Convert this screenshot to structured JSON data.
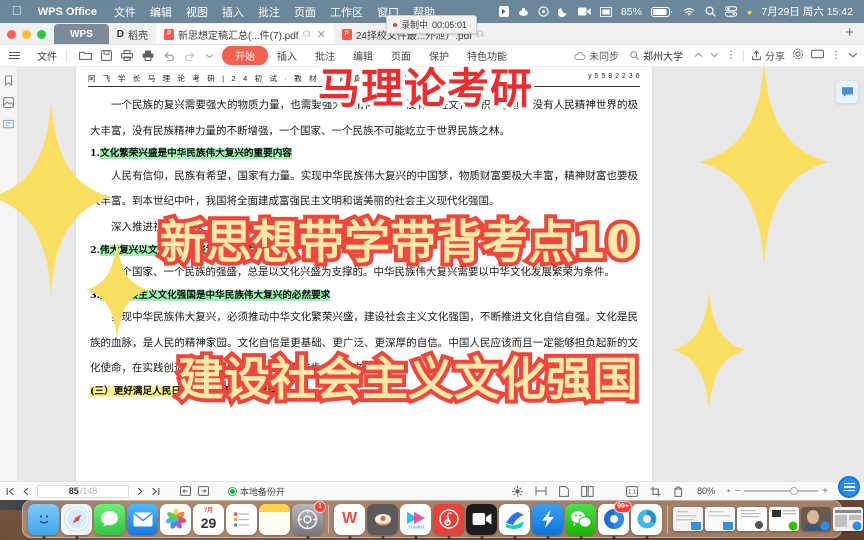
{
  "menubar": {
    "apple_icon": "apple-icon",
    "app_name": "WPS Office",
    "items": [
      "文件",
      "编辑",
      "视图",
      "插入",
      "批注",
      "页面",
      "工作区",
      "窗口",
      "帮助"
    ],
    "battery": "85%",
    "datetime": "7月29日 周六  15:42",
    "right_icons": [
      "input-source-icon",
      "screenshot-icon",
      "record-circle-icon",
      "do-not-disturb-moon-icon",
      "camera-icon",
      "keyboard-icon",
      "battery-icon",
      "wifi-icon",
      "search-icon",
      "control-center-icon"
    ]
  },
  "recording": {
    "label": "录制中",
    "time": "00:05:01"
  },
  "tabs": {
    "wps_label": "WPS",
    "docer_label": "稻壳",
    "items": [
      {
        "label": "新思想定稿汇总(...件(7).pdf",
        "active": true
      },
      {
        "label": "24择校文件最...外泄）.pdf",
        "active": false
      }
    ],
    "new_tab": "+"
  },
  "ribbon": {
    "file_label": "文件",
    "tabs": [
      {
        "label": "开始",
        "active": true
      },
      {
        "label": "插入",
        "active": false
      },
      {
        "label": "批注",
        "active": false
      },
      {
        "label": "编辑",
        "active": false
      },
      {
        "label": "页面",
        "active": false
      },
      {
        "label": "保护",
        "active": false
      },
      {
        "label": "特色功能",
        "active": false
      }
    ],
    "sync_status": "未同步",
    "search_value": "郑州大学",
    "share_label": "分享",
    "icons": [
      "folder-open-icon",
      "save-icon",
      "print-icon",
      "print-filled-icon",
      "undo-icon",
      "redo-icon",
      "dropdown-icon"
    ]
  },
  "document": {
    "header_left": "阿 飞 学 长 马 理 论 考 研 | 2 4 初 试 · 教 材 带 背 真 命 系 列 · ( 新 思 想 )",
    "header_right": "y 5 5 8 2 2 3 6",
    "paragraphs": [
      {
        "type": "para",
        "indent": true,
        "text": "一个民族的复兴需要强大的物质力量，也需要强大的精神力量。没有先进文化的积极引领，没有人民精神世界的极大丰富，没有民族精神力量的不断增强，一个国家、一个民族不可能屹立于世界民族之林。"
      },
      {
        "type": "heading",
        "num": "1.",
        "text": "文化繁荣兴盛是中华民族伟大复兴的重要内容",
        "highlight": "green"
      },
      {
        "type": "para",
        "indent": true,
        "text": "人民有信仰，民族有希望，国家有力量。实现中华民族伟大复兴的中国梦，物质财富要极大丰富，精神财富也要极大丰富。到本世纪中叶，我国将全面建成富强民主文明和谐美丽的社会主义现代化强国。"
      },
      {
        "type": "para",
        "indent": true,
        "text": "深入推进社会主义文化强国建设，不断丰富人民精神世界，增强人民精神力量。"
      },
      {
        "type": "heading",
        "num": "2.",
        "text": "伟大复兴以文化繁荣兴盛为支撑条件",
        "highlight": "green"
      },
      {
        "type": "para",
        "indent": true,
        "text": "一个国家、一个民族的强盛，总是以文化兴盛为支撑的。中华民族伟大复兴需要以中华文化发展繁荣为条件。"
      },
      {
        "type": "heading",
        "num": "3.",
        "text": "建设社会主义文化强国是中华民族伟大复兴的必然要求",
        "highlight": "green"
      },
      {
        "type": "para",
        "indent": true,
        "text": "实现中华民族伟大复兴，必须推动中华文化繁荣兴盛，建设社会主义文化强国，不断推进文化自信自强。文化是民族的血脉，是人民的精神家园。文化自信是更基础、更广泛、更深厚的自信。中国人民应该而且一定能够担负起新的文化使命，在实践创造中进行文化创造，在历史进步中实现文化进步!"
      },
      {
        "type": "heading",
        "num": "",
        "text": "(三）更好满足人民日益增长的精神文化需要",
        "highlight": "yellow"
      }
    ],
    "highlight_colors": {
      "green": "#9ff2b4",
      "cyan": "#a7e6f0",
      "yellow": "#fbf08a"
    }
  },
  "captions": [
    {
      "id": "cap1",
      "text": "马理论考研",
      "fill": "#ef2c2c",
      "stroke": "#ffffff"
    },
    {
      "id": "cap2",
      "text": "新思想带学带背考点10",
      "fill": "#fde9a8",
      "stroke": "#f2453c"
    },
    {
      "id": "cap3",
      "text": "建设社会主义文化强国",
      "fill": "#fde9a8",
      "stroke": "#f2453c"
    }
  ],
  "sparkles": {
    "color": "#fbdf63"
  },
  "statusbar": {
    "page_current": "85",
    "page_total": "/148",
    "backup_label": "本地备份开",
    "zoom": "80%",
    "icons": [
      "first-page-icon",
      "prev-page-icon",
      "next-page-icon",
      "last-page-icon",
      "fit-width-icon",
      "fit-page-icon",
      "brightness-icon",
      "split-view-icon",
      "single-page-icon",
      "double-page-icon",
      "thumbnail-icon",
      "crop-icon",
      "rotate-icon"
    ]
  },
  "dock": {
    "apps": [
      {
        "name": "finder-icon",
        "glyph": "☺",
        "bg": "#3fa7f0",
        "open": true
      },
      {
        "name": "safari-icon",
        "glyph": "🧭",
        "bg": "#f2f6fa",
        "open": true
      },
      {
        "name": "messages-icon",
        "glyph": "💬",
        "bg": "#4cd964",
        "open": false
      },
      {
        "name": "mail-icon",
        "glyph": "✉",
        "bg": "#1e9df5",
        "open": false
      },
      {
        "name": "photos-icon",
        "glyph": "❀",
        "bg": "#ffffff",
        "open": false
      },
      {
        "name": "calendar-icon",
        "glyph": "29",
        "bg": "#ffffff",
        "open": false,
        "top": "7月"
      },
      {
        "name": "reminders-icon",
        "glyph": "≔",
        "bg": "#ffffff",
        "open": false
      },
      {
        "name": "notes-icon",
        "glyph": "▤",
        "bg": "#ffe066",
        "open": false
      },
      {
        "name": "system-preferences-icon",
        "glyph": "⚙",
        "bg": "#8e8e93",
        "open": true,
        "badge": "1"
      },
      {
        "name": "wps-office-icon",
        "glyph": "W",
        "bg": "#ffffff",
        "open": true
      },
      {
        "name": "quicktime-icon",
        "glyph": "◉",
        "bg": "#5a5a5a",
        "open": true
      },
      {
        "name": "youku-icon",
        "glyph": "▶",
        "bg": "#ffffff",
        "open": true
      },
      {
        "name": "netease-music-icon",
        "glyph": "♪",
        "bg": "#e8413a",
        "open": true
      },
      {
        "name": "screen-recorder-icon",
        "glyph": "🎬",
        "bg": "#1c1c1e",
        "open": true
      },
      {
        "name": "feishu-icon",
        "glyph": "✈",
        "bg": "#ffffff",
        "open": true
      },
      {
        "name": "dingtalk-icon",
        "glyph": "➤",
        "bg": "#1e8cf0",
        "open": true
      },
      {
        "name": "wechat-icon",
        "glyph": "✆",
        "bg": "#2dc100",
        "open": true
      },
      {
        "name": "qq-music-icon",
        "glyph": "◐",
        "bg": "#ffffff",
        "open": true,
        "badge": "99+"
      },
      {
        "name": "browser-icon",
        "glyph": "◓",
        "bg": "#ffffff",
        "open": true
      }
    ],
    "minimized_count": 7,
    "trash": "trash-icon"
  }
}
